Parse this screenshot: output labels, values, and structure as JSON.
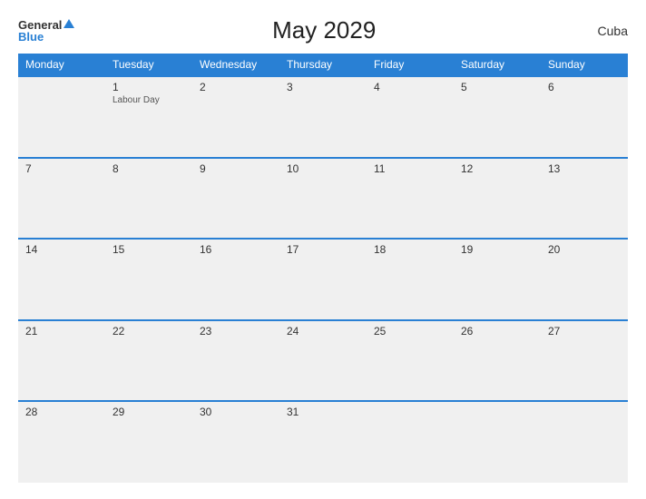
{
  "header": {
    "logo_general": "General",
    "logo_blue": "Blue",
    "title": "May 2029",
    "country": "Cuba"
  },
  "days_of_week": [
    "Monday",
    "Tuesday",
    "Wednesday",
    "Thursday",
    "Friday",
    "Saturday",
    "Sunday"
  ],
  "weeks": [
    [
      {
        "day": "",
        "event": ""
      },
      {
        "day": "1",
        "event": "Labour Day"
      },
      {
        "day": "2",
        "event": ""
      },
      {
        "day": "3",
        "event": ""
      },
      {
        "day": "4",
        "event": ""
      },
      {
        "day": "5",
        "event": ""
      },
      {
        "day": "6",
        "event": ""
      }
    ],
    [
      {
        "day": "7",
        "event": ""
      },
      {
        "day": "8",
        "event": ""
      },
      {
        "day": "9",
        "event": ""
      },
      {
        "day": "10",
        "event": ""
      },
      {
        "day": "11",
        "event": ""
      },
      {
        "day": "12",
        "event": ""
      },
      {
        "day": "13",
        "event": ""
      }
    ],
    [
      {
        "day": "14",
        "event": ""
      },
      {
        "day": "15",
        "event": ""
      },
      {
        "day": "16",
        "event": ""
      },
      {
        "day": "17",
        "event": ""
      },
      {
        "day": "18",
        "event": ""
      },
      {
        "day": "19",
        "event": ""
      },
      {
        "day": "20",
        "event": ""
      }
    ],
    [
      {
        "day": "21",
        "event": ""
      },
      {
        "day": "22",
        "event": ""
      },
      {
        "day": "23",
        "event": ""
      },
      {
        "day": "24",
        "event": ""
      },
      {
        "day": "25",
        "event": ""
      },
      {
        "day": "26",
        "event": ""
      },
      {
        "day": "27",
        "event": ""
      }
    ],
    [
      {
        "day": "28",
        "event": ""
      },
      {
        "day": "29",
        "event": ""
      },
      {
        "day": "30",
        "event": ""
      },
      {
        "day": "31",
        "event": ""
      },
      {
        "day": "",
        "event": ""
      },
      {
        "day": "",
        "event": ""
      },
      {
        "day": "",
        "event": ""
      }
    ]
  ]
}
